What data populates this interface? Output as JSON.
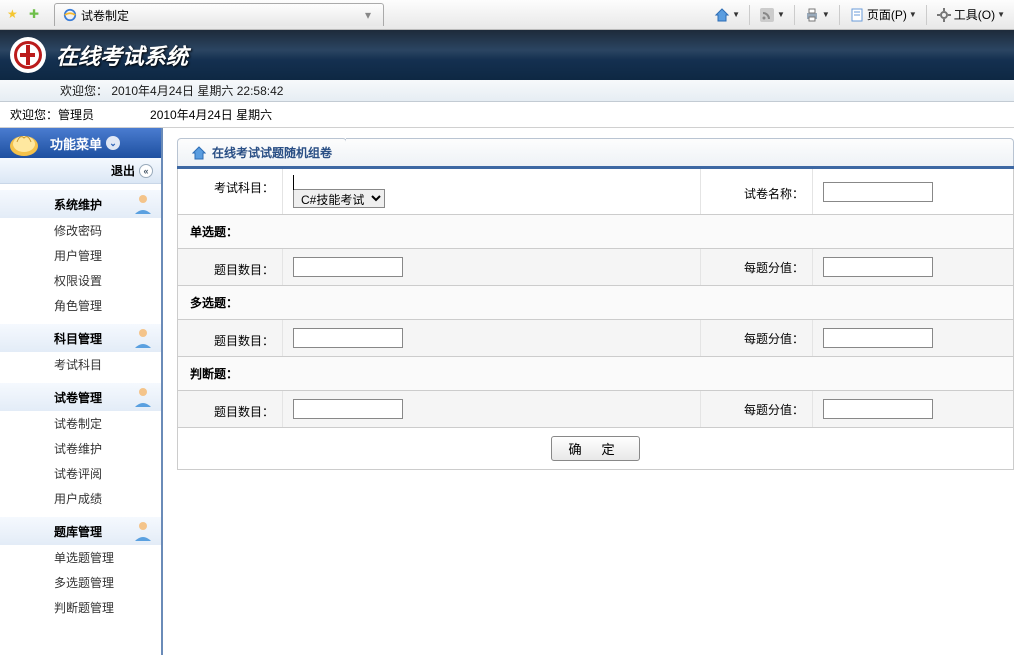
{
  "browser": {
    "tab_title": "试卷制定",
    "toolbar": {
      "home": "主页",
      "rss": "RSS",
      "print": "打印",
      "page": "页面(P)",
      "tools": "工具(O)"
    }
  },
  "header": {
    "app_title": "在线考试系统",
    "welcome_line": "欢迎您： 2010年4月24日 星期六  22:58:42",
    "welcome2_a": "欢迎您：管理员",
    "welcome2_b": "2010年4月24日 星期六"
  },
  "sidebar": {
    "menu_title": "功能菜单",
    "exit": "退出",
    "groups": [
      {
        "head": "系统维护",
        "items": [
          "修改密码",
          "用户管理",
          "权限设置",
          "角色管理"
        ]
      },
      {
        "head": "科目管理",
        "items": [
          "考试科目"
        ]
      },
      {
        "head": "试卷管理",
        "items": [
          "试卷制定",
          "试卷维护",
          "试卷评阅",
          "用户成绩"
        ]
      },
      {
        "head": "题库管理",
        "items": [
          "单选题管理",
          "多选题管理",
          "判断题管理"
        ]
      }
    ]
  },
  "content": {
    "tab_title": "在线考试试题随机组卷",
    "form": {
      "subject_label": "考试科目：",
      "subject_select": "C#技能考试",
      "paper_name_label": "试卷名称：",
      "sections": {
        "single": "单选题：",
        "multi": "多选题：",
        "judge": "判断题："
      },
      "count_label": "题目数目：",
      "score_label": "每题分值：",
      "submit": "确 定"
    }
  }
}
